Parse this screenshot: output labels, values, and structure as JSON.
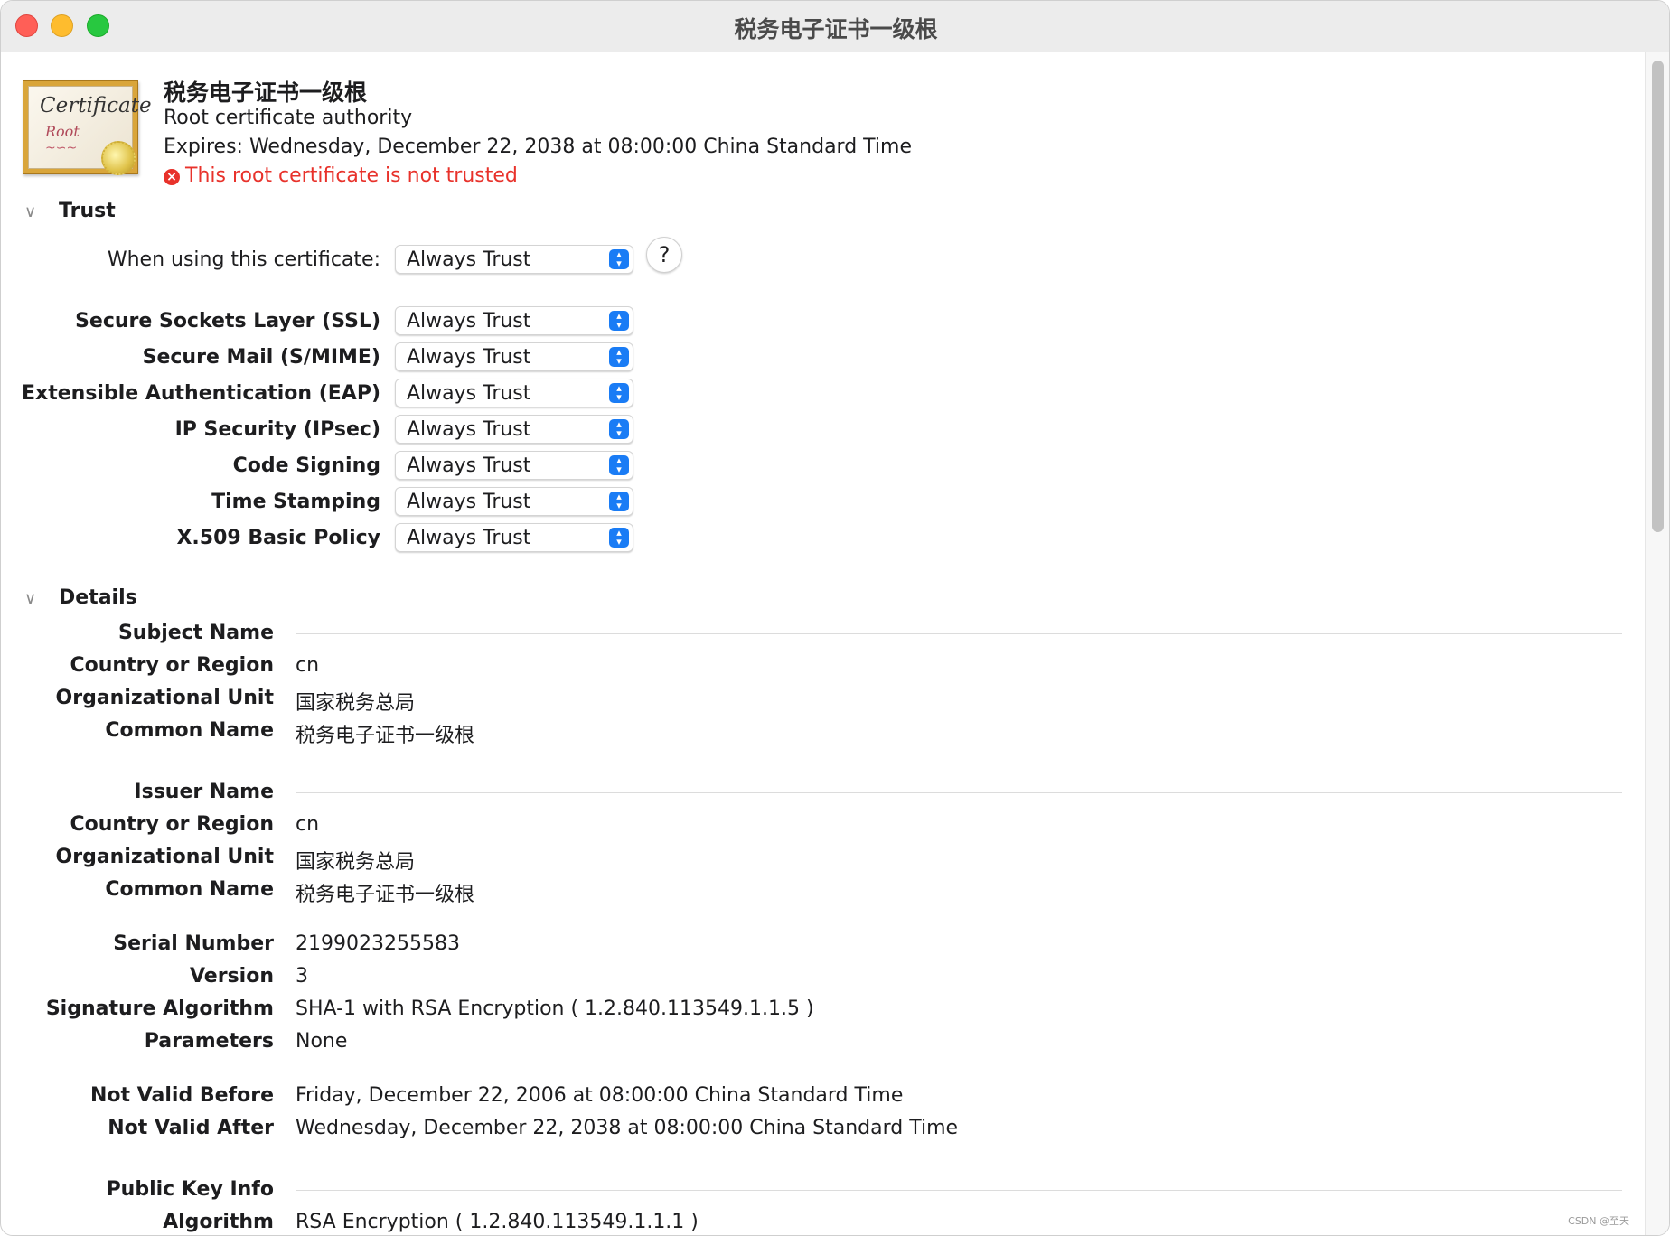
{
  "window": {
    "title": "税务电子证书一级根"
  },
  "header": {
    "name": "税务电子证书一级根",
    "type": "Root certificate authority",
    "expires": "Expires: Wednesday, December 22, 2038 at 08:00:00 China Standard Time",
    "warning": "This root certificate is not trusted",
    "icon_text_1": "Certificate",
    "icon_text_2": "Root"
  },
  "trust": {
    "section_label": "Trust",
    "when_using_label": "When using this certificate:",
    "when_using_value": "Always Trust",
    "help_label": "?",
    "policies": [
      {
        "label": "Secure Sockets Layer (SSL)",
        "value": "Always Trust"
      },
      {
        "label": "Secure Mail (S/MIME)",
        "value": "Always Trust"
      },
      {
        "label": "Extensible Authentication (EAP)",
        "value": "Always Trust"
      },
      {
        "label": "IP Security (IPsec)",
        "value": "Always Trust"
      },
      {
        "label": "Code Signing",
        "value": "Always Trust"
      },
      {
        "label": "Time Stamping",
        "value": "Always Trust"
      },
      {
        "label": "X.509 Basic Policy",
        "value": "Always Trust"
      }
    ]
  },
  "details": {
    "section_label": "Details",
    "subject_name": {
      "heading": "Subject Name",
      "country_label": "Country or Region",
      "country": "cn",
      "org_unit_label": "Organizational Unit",
      "org_unit": "国家税务总局",
      "common_name_label": "Common Name",
      "common_name": "税务电子证书一级根"
    },
    "issuer_name": {
      "heading": "Issuer Name",
      "country_label": "Country or Region",
      "country": "cn",
      "org_unit_label": "Organizational Unit",
      "org_unit": "国家税务总局",
      "common_name_label": "Common Name",
      "common_name": "税务电子证书一级根"
    },
    "serial_number_label": "Serial Number",
    "serial_number": "2199023255583",
    "version_label": "Version",
    "version": "3",
    "signature_algorithm_label": "Signature Algorithm",
    "signature_algorithm": "SHA-1 with RSA Encryption ( 1.2.840.113549.1.1.5 )",
    "parameters_label": "Parameters",
    "parameters": "None",
    "not_valid_before_label": "Not Valid Before",
    "not_valid_before": "Friday, December 22, 2006 at 08:00:00 China Standard Time",
    "not_valid_after_label": "Not Valid After",
    "not_valid_after": "Wednesday, December 22, 2038 at 08:00:00 China Standard Time",
    "public_key_info_heading": "Public Key Info",
    "algorithm_label": "Algorithm",
    "algorithm": "RSA Encryption ( 1.2.840.113549.1.1.1 )"
  },
  "watermark": "CSDN @至天",
  "icons": {
    "warning": "x-circle-icon",
    "chevron": "chevron-down-icon",
    "popup": "up-down-arrows-icon"
  },
  "colors": {
    "accent": "#1a7cf5",
    "warning": "#e8322b"
  }
}
